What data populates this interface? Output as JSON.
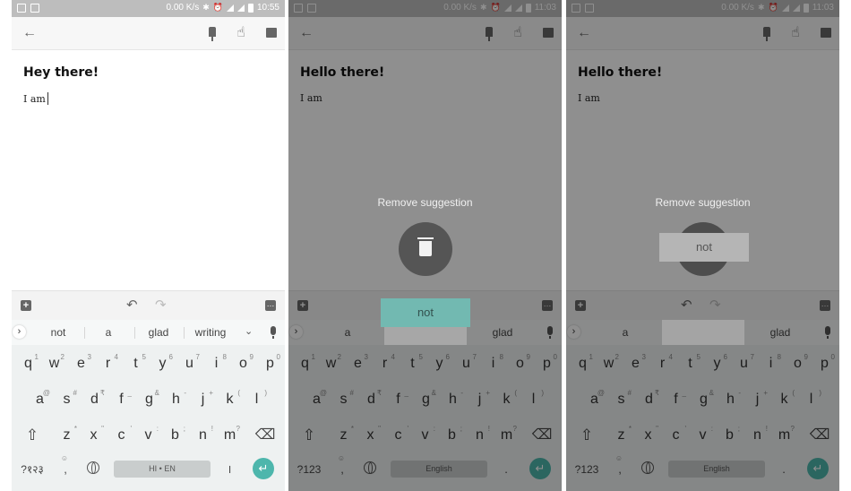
{
  "status": {
    "speed": "0.00 K/s",
    "times": [
      "10:55",
      "11:03",
      "11:03"
    ]
  },
  "notes": [
    {
      "title": "Hey there!",
      "body": "I am"
    },
    {
      "title": "Hello there!",
      "body": "I am"
    },
    {
      "title": "Hello there!",
      "body": "I am"
    }
  ],
  "suggestions": {
    "screen1": [
      "not",
      "a",
      "glad",
      "writing"
    ],
    "screen2": [
      "a",
      "glad"
    ],
    "screen3": [
      "a",
      "glad"
    ]
  },
  "dragged_suggestion": "not",
  "remove_suggestion_label": "Remove suggestion",
  "keyboard": {
    "row1": [
      "q",
      "w",
      "e",
      "r",
      "t",
      "y",
      "u",
      "i",
      "o",
      "p"
    ],
    "row1_hints": [
      "1",
      "2",
      "3",
      "4",
      "5",
      "6",
      "7",
      "8",
      "9",
      "0"
    ],
    "row2": [
      "a",
      "s",
      "d",
      "f",
      "g",
      "h",
      "j",
      "k",
      "l"
    ],
    "row2_hints": [
      "@",
      "#",
      "₹",
      "_",
      "&",
      "-",
      "+",
      "(",
      ")"
    ],
    "row3": [
      "z",
      "x",
      "c",
      "v",
      "b",
      "n",
      "m"
    ],
    "row3_hints": [
      "*",
      "\"",
      "'",
      ":",
      ";",
      "!",
      "?"
    ],
    "symbols_hindi": "?१२३",
    "symbols_en": "?123",
    "emoji_hint": "☺",
    "comma": ",",
    "period": ".",
    "hindi_period": "।",
    "space_hindi": "HI • EN",
    "space_english": "English"
  },
  "icons": {
    "back": "←",
    "pin": "pin-icon",
    "reminder": "hand-pointer-icon",
    "archive": "archive-icon",
    "add": "+",
    "undo": "↶",
    "redo": "↷",
    "more": "…",
    "expand": "›",
    "collapse": "⌄",
    "shift": "⇧",
    "backspace": "⌫",
    "enter": "↵",
    "bluetooth": "✱",
    "alarm": "⏰"
  },
  "colors": {
    "accent_teal": "#4db6ac",
    "drag_chip_teal": "#72b9b1",
    "overlay": "#808080"
  }
}
